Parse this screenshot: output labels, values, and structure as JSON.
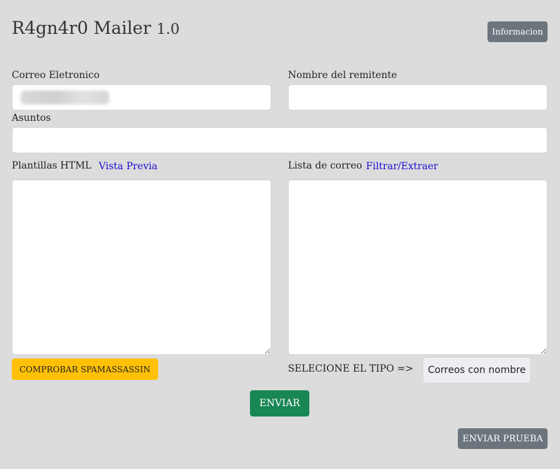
{
  "header": {
    "title": "R4gn4r0 Mailer",
    "version": "1.0",
    "info_button": "Informacion"
  },
  "form": {
    "email_label": "Correo Eletronico",
    "email_value": "",
    "sender_label": "Nombre del remitente",
    "sender_value": "",
    "subject_label": "Asuntos",
    "subject_value": "",
    "template_label": "Plantillas HTML",
    "preview_link": "Vista Previa",
    "list_label": "Lista de correo",
    "filter_link": "Filtrar/Extraer",
    "template_value": "",
    "list_value": ""
  },
  "actions": {
    "spam_check": "COMPROBAR SPAMASSASSIN",
    "select_type_label": "SELECIONE EL TIPO =>",
    "type_selected": "Correos con nombre",
    "send": "ENVIAR",
    "send_test": "ENVIAR PRUEBA"
  },
  "colors": {
    "background": "#dcdcdc",
    "info_button": "#6c757d",
    "spam_button": "#ffc107",
    "send_button": "#198754",
    "link": "#1a0dd6"
  }
}
